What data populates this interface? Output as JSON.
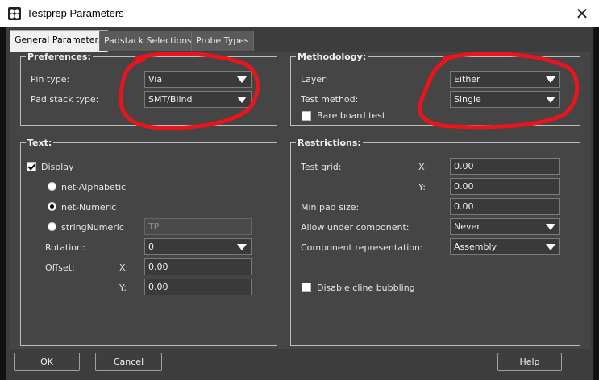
{
  "window": {
    "title": "Testprep Parameters",
    "close_glyph": "✕"
  },
  "tabs": [
    {
      "label": "General Parameters",
      "active": true
    },
    {
      "label": "Padstack Selections",
      "active": false
    },
    {
      "label": "Probe Types",
      "active": false
    }
  ],
  "preferences": {
    "legend": "Preferences:",
    "pin_type_label": "Pin type:",
    "pin_type_value": "Via",
    "pad_stack_label": "Pad stack type:",
    "pad_stack_value": "SMT/Blind"
  },
  "methodology": {
    "legend": "Methodology:",
    "layer_label": "Layer:",
    "layer_value": "Either",
    "test_method_label": "Test method:",
    "test_method_value": "Single",
    "bare_board_label": "Bare board test",
    "bare_board_checked": false
  },
  "text_group": {
    "legend": "Text:",
    "display_label": "Display",
    "display_checked": true,
    "radio_alpha": "net-Alphabetic",
    "radio_numeric": "net-Numeric",
    "radio_string": "stringNumeric",
    "selected_radio": "net-Numeric",
    "string_value": "TP",
    "rotation_label": "Rotation:",
    "rotation_value": "0",
    "offset_label": "Offset:",
    "x_label": "X:",
    "x_value": "0.00",
    "y_label": "Y:",
    "y_value": "0.00"
  },
  "restrictions": {
    "legend": "Restrictions:",
    "test_grid_label": "Test grid:",
    "x_label": "X:",
    "x_value": "0.00",
    "y_label": "Y:",
    "y_value": "0.00",
    "min_pad_label": "Min pad size:",
    "min_pad_value": "0.00",
    "allow_under_label": "Allow under component:",
    "allow_under_value": "Never",
    "comp_rep_label": "Component representation:",
    "comp_rep_value": "Assembly",
    "disable_cline_label": "Disable cline bubbling",
    "disable_cline_checked": false
  },
  "buttons": {
    "ok": "OK",
    "cancel": "Cancel",
    "help": "Help"
  },
  "annotation_color": "#e8141e"
}
